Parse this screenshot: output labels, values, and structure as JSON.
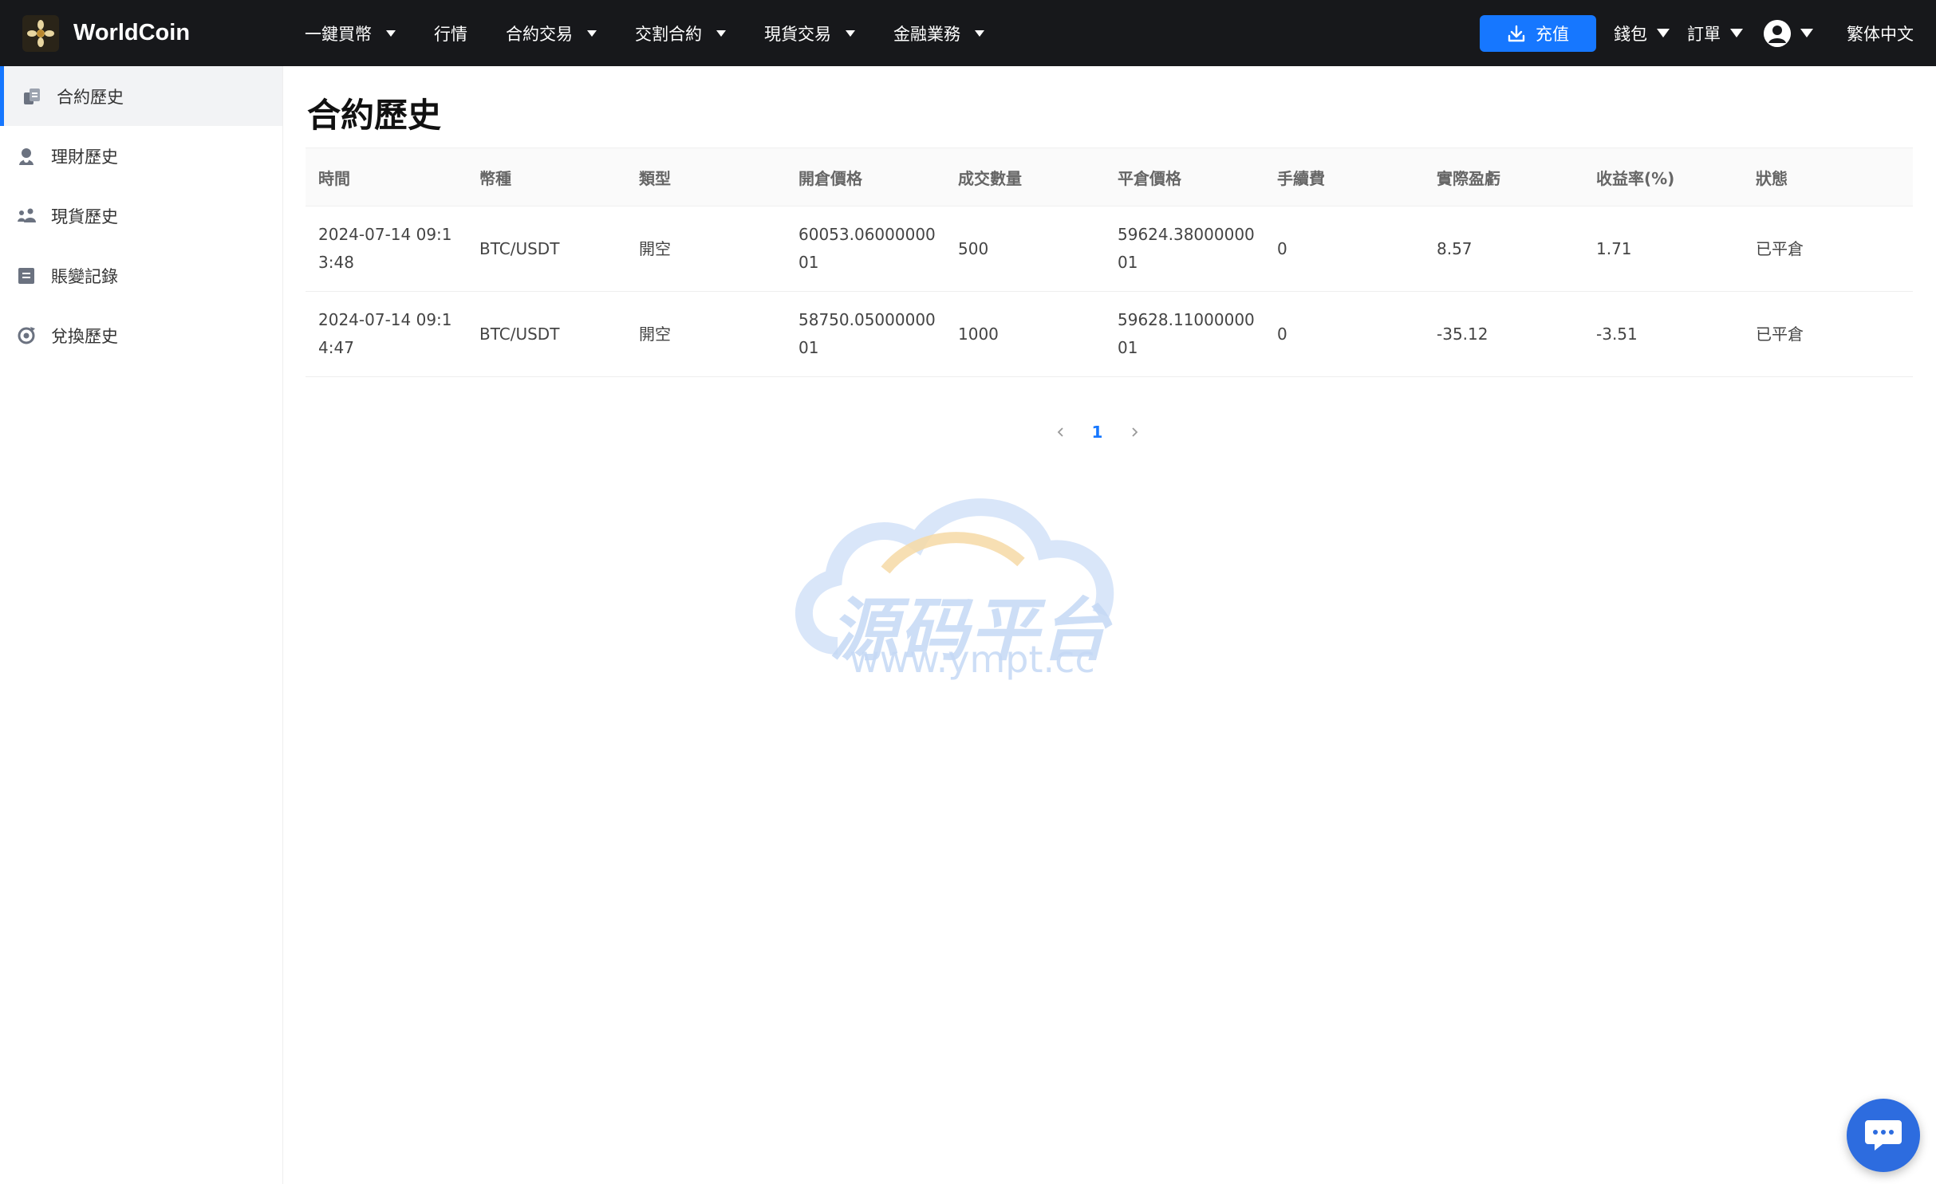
{
  "brand": {
    "name": "WorldCoin"
  },
  "nav": {
    "items": [
      {
        "label": "一鍵買幣",
        "dropdown": true
      },
      {
        "label": "行情",
        "dropdown": false
      },
      {
        "label": "合約交易",
        "dropdown": true
      },
      {
        "label": "交割合約",
        "dropdown": true
      },
      {
        "label": "現貨交易",
        "dropdown": true
      },
      {
        "label": "金融業務",
        "dropdown": true
      }
    ]
  },
  "topright": {
    "recharge_label": "充值",
    "wallet_label": "錢包",
    "orders_label": "訂單",
    "language_label": "繁体中文"
  },
  "sidebar": {
    "items": [
      {
        "label": "合約歷史",
        "icon": "contract-history-icon",
        "active": true
      },
      {
        "label": "理財歷史",
        "icon": "finance-history-icon",
        "active": false
      },
      {
        "label": "現貨歷史",
        "icon": "spot-history-icon",
        "active": false
      },
      {
        "label": "賬變記錄",
        "icon": "account-record-icon",
        "active": false
      },
      {
        "label": "兌換歷史",
        "icon": "exchange-history-icon",
        "active": false
      }
    ]
  },
  "main": {
    "title": "合約歷史",
    "columns": [
      "時間",
      "幣種",
      "類型",
      "開倉價格",
      "成交數量",
      "平倉價格",
      "手續費",
      "實際盈虧",
      "收益率(%)",
      "狀態"
    ],
    "rows": [
      {
        "time": "2024-07-14 09:13:48",
        "coin": "BTC/USDT",
        "type": "開空",
        "open_price": "60053.0600000001",
        "quantity": "500",
        "close_price": "59624.3800000001",
        "fee": "0",
        "pnl": "8.57",
        "yield": "1.71",
        "status": "已平倉"
      },
      {
        "time": "2024-07-14 09:14:47",
        "coin": "BTC/USDT",
        "type": "開空",
        "open_price": "58750.0500000001",
        "quantity": "1000",
        "close_price": "59628.1100000001",
        "fee": "0",
        "pnl": "-35.12",
        "yield": "-3.51",
        "status": "已平倉"
      }
    ]
  },
  "pagination": {
    "current": "1"
  },
  "watermark": {
    "title": "源码平台",
    "url": "www.ympt.cc"
  },
  "colors": {
    "accent": "#1677ff",
    "positive": "#1e8e4e",
    "negative": "#c0392b",
    "topbar": "#17181b"
  }
}
